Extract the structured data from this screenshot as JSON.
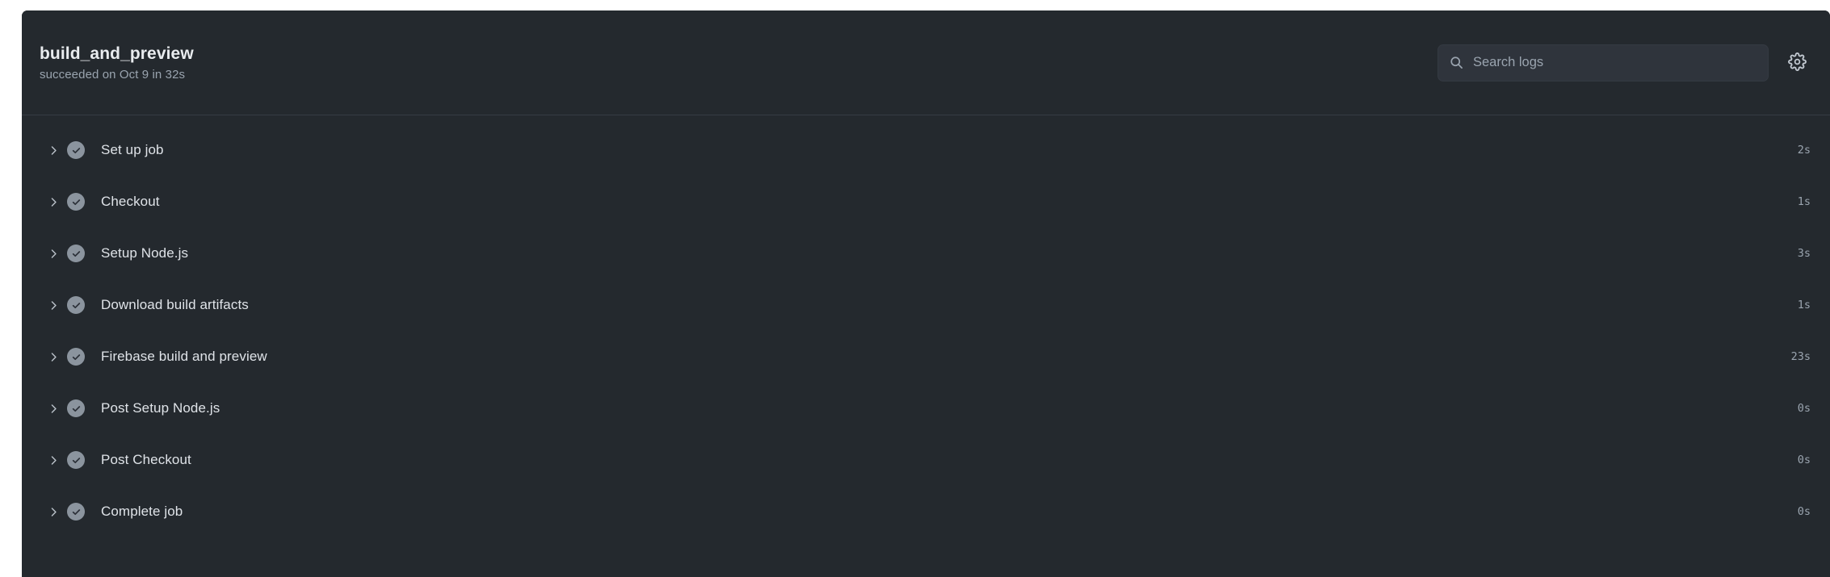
{
  "job": {
    "title": "build_and_preview",
    "subtitle": "succeeded on Oct 9 in 32s"
  },
  "search": {
    "placeholder": "Search logs",
    "value": ""
  },
  "toolbar": {
    "settings_icon": "gear-icon",
    "search_icon": "search-icon"
  },
  "colors": {
    "panel_bg": "#24292e",
    "divider": "#363c44",
    "search_bg": "#2f343c",
    "success_icon": "#8b949e",
    "text_primary": "#dfe3e8",
    "text_muted": "#9aa4af"
  },
  "steps": [
    {
      "name": "Set up job",
      "duration": "2s",
      "status": "succeeded",
      "expanded": false
    },
    {
      "name": "Checkout",
      "duration": "1s",
      "status": "succeeded",
      "expanded": false
    },
    {
      "name": "Setup Node.js",
      "duration": "3s",
      "status": "succeeded",
      "expanded": false
    },
    {
      "name": "Download build artifacts",
      "duration": "1s",
      "status": "succeeded",
      "expanded": false
    },
    {
      "name": "Firebase build and preview",
      "duration": "23s",
      "status": "succeeded",
      "expanded": false
    },
    {
      "name": "Post Setup Node.js",
      "duration": "0s",
      "status": "succeeded",
      "expanded": false
    },
    {
      "name": "Post Checkout",
      "duration": "0s",
      "status": "succeeded",
      "expanded": false
    },
    {
      "name": "Complete job",
      "duration": "0s",
      "status": "succeeded",
      "expanded": false
    }
  ]
}
